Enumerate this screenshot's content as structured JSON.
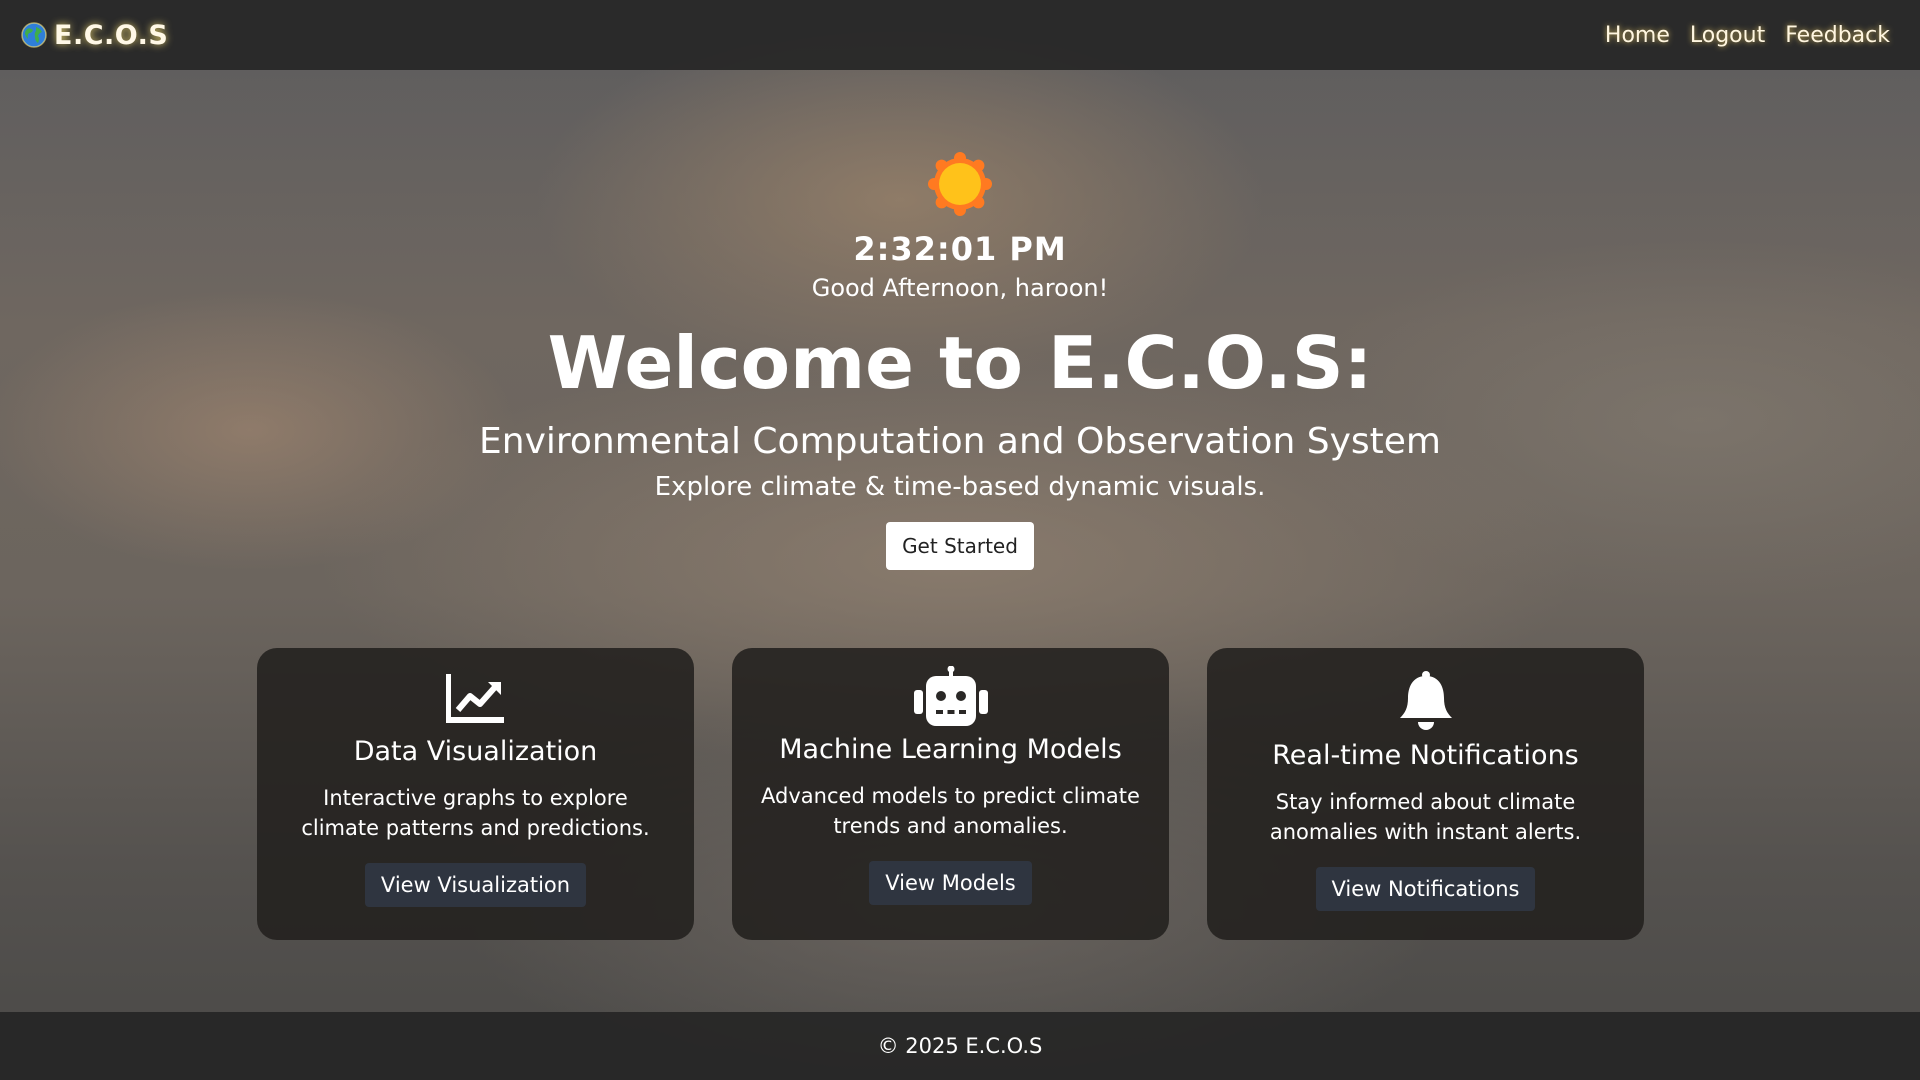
{
  "navbar": {
    "brand_icon": "globe-icon",
    "brand_text": "E.C.O.S",
    "links": [
      "Home",
      "Logout",
      "Feedback"
    ]
  },
  "hero": {
    "weather_icon": "sun-icon",
    "time": "2:32:01 PM",
    "greeting": "Good Afternoon, haroon!",
    "title": "Welcome to E.C.O.S:",
    "subtitle": "Environmental Computation and Observation System",
    "tagline": "Explore climate & time-based dynamic visuals.",
    "cta_label": "Get Started"
  },
  "cards": [
    {
      "icon": "chart-line-icon",
      "title": "Data Visualization",
      "description": "Interactive graphs to explore climate patterns and predictions.",
      "button": "View Visualization"
    },
    {
      "icon": "robot-icon",
      "title": "Machine Learning Models",
      "description": "Advanced models to predict climate trends and anomalies.",
      "button": "View Models"
    },
    {
      "icon": "bell-icon",
      "title": "Real-time Notifications",
      "description": "Stay informed about climate anomalies with instant alerts.",
      "button": "View Notifications"
    }
  ],
  "footer": {
    "text": "© 2025 E.C.O.S"
  },
  "colors": {
    "navbar_bg": "#262626",
    "card_bg": "#22201e",
    "card_button_bg": "#2f3540",
    "glow": "#ffe078",
    "sun_outer": "#ff7a21",
    "sun_inner": "#ffc21a"
  }
}
